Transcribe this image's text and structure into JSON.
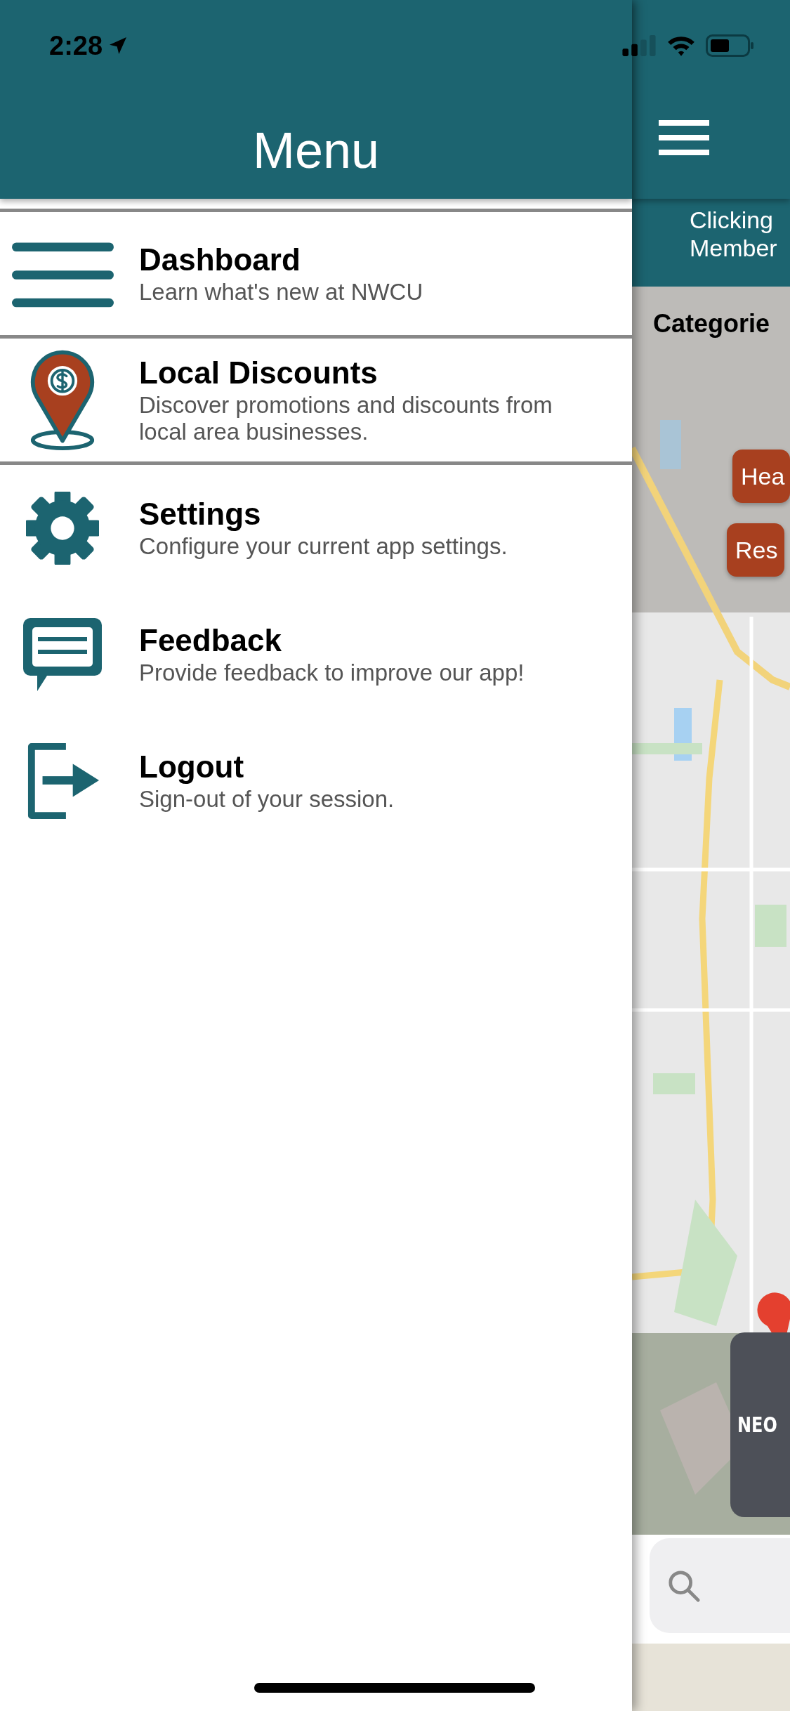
{
  "status_bar": {
    "time": "2:28"
  },
  "drawer": {
    "title": "Menu",
    "items": [
      {
        "kind": "dashboard",
        "title": "Dashboard",
        "subtitle": "Learn what's new at NWCU",
        "divider_below": true
      },
      {
        "kind": "discounts",
        "title": "Local Discounts",
        "subtitle": "Discover promotions and discounts from local area businesses.",
        "divider_below": true
      },
      {
        "kind": "settings",
        "title": "Settings",
        "subtitle": "Configure your current app settings.",
        "divider_below": false
      },
      {
        "kind": "feedback",
        "title": "Feedback",
        "subtitle": "Provide feedback to improve our app!",
        "divider_below": false
      },
      {
        "kind": "logout",
        "title": "Logout",
        "subtitle": "Sign-out of your session.",
        "divider_below": false
      }
    ]
  },
  "background_screen": {
    "banner": [
      "Clicking",
      "Member"
    ],
    "categories_label": "Categorie",
    "category_buttons": [
      "Hea",
      "Res"
    ],
    "card_label": "NEO"
  }
}
